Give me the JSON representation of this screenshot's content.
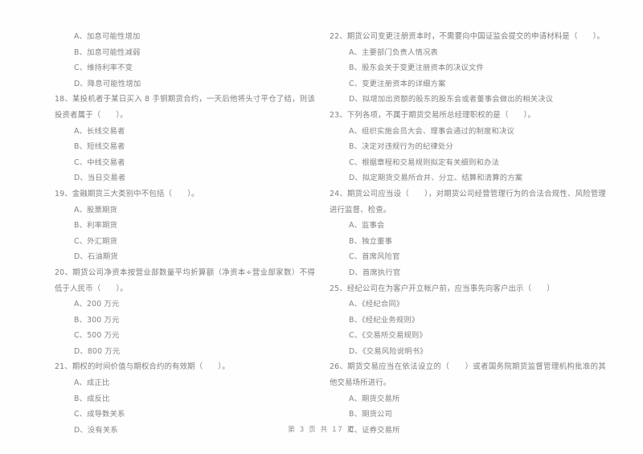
{
  "document": {
    "type": "scanned-exam-paper",
    "page_footer": "第 3 页  共 17 页"
  },
  "left_column": {
    "continued_options": [
      "A、加息可能性增加",
      "B、加息可能性减弱",
      "C、维持利率不变",
      "D、降息可能性增加"
    ],
    "questions": [
      {
        "number": "18",
        "stem": "18、某投机者于某日买入 8 手铜期货合约，一天后他将头寸平仓了结，则该投资者属于（　　）。",
        "options": [
          "A、长线交易者",
          "B、短线交易者",
          "C、中线交易者",
          "D、当日交易者"
        ]
      },
      {
        "number": "19",
        "stem": "19、金融期货三大类别中不包括（　　）。",
        "options": [
          "A、股票期货",
          "B、利率期货",
          "C、外汇期货",
          "D、石油期货"
        ]
      },
      {
        "number": "20",
        "stem": "20、期货公司净资本按营业部数量平均折算额（净资本÷营业部家数）不得低于人民币（　　）。",
        "options": [
          "A、200 万元",
          "B、300 万元",
          "C、500 万元",
          "D、800 万元"
        ]
      },
      {
        "number": "21",
        "stem": "21、期权的时间价值与期权合约的有效期（　　）。",
        "options": [
          "A、成正比",
          "B、成反比",
          "C、成导数关系",
          "D、没有关系"
        ]
      }
    ]
  },
  "right_column": {
    "questions": [
      {
        "number": "22",
        "stem": "22、期货公司变更注册资本时，不需要向中国证监会提交的申请材料是（　　）。",
        "options": [
          "A、主要部门负责人情况表",
          "B、股东会关于变更注册资本的决议文件",
          "C、变更注册资本的详细方案",
          "D、拟增加出资额的股东的股东会或者董事会做出的相关决议"
        ]
      },
      {
        "number": "23",
        "stem": "23、下列各项，不属于期货交易所总经理职权的是（　　）。",
        "options": [
          "A、组织实施会员大会、理事会通过的制度和决议",
          "B、决定对违规行为的纪律处分",
          "C、根据章程和交易规则拟定有关细则和办法",
          "D、拟定期货交易所合并、分立、结算和清算的方案"
        ]
      },
      {
        "number": "24",
        "stem": "24、期货公司应当设（　　），对期货公司经营管理行为的合法合规性、风险管理进行监督、检查。",
        "options": [
          "A、监事会",
          "B、独立董事",
          "C、首席风险官",
          "D、首席执行官"
        ]
      },
      {
        "number": "25",
        "stem": "25、经纪公司在为客户开立帐户前，应当事先向客户出示（　　）",
        "options": [
          "A、《经纪合同》",
          "B、《经纪业务规则》",
          "C、《交易所交易规则》",
          "D、《交易风险说明书》"
        ]
      },
      {
        "number": "26",
        "stem": "26、期货交易应当在依法设立的（　　）或者国务院期货监督管理机构批准的其他交易场所进行。",
        "options": [
          "A、期货交易所",
          "B、期货公司",
          "C、证券交易所"
        ]
      }
    ]
  }
}
